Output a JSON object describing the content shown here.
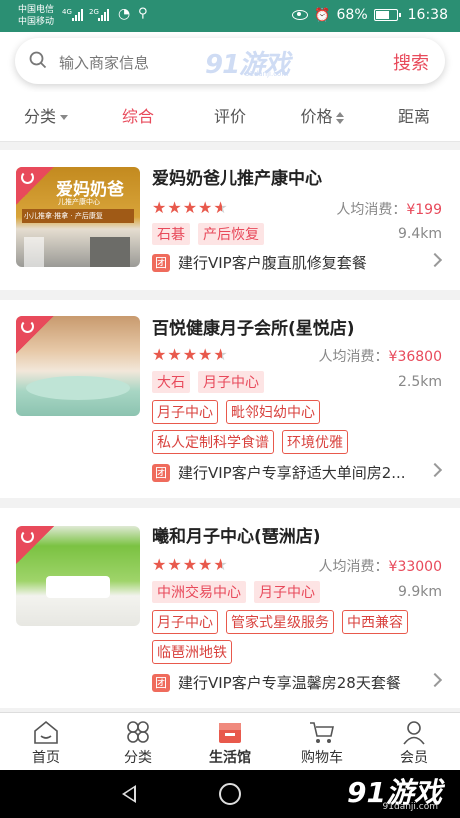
{
  "status_bar": {
    "carrier1": "中国电信",
    "carrier2": "中国移动",
    "net1": "4G",
    "net2": "2G",
    "battery": "68%",
    "time": "16:38"
  },
  "search": {
    "placeholder": "输入商家信息",
    "button": "搜索",
    "watermark": "91游戏",
    "watermark_url": "91danji.com"
  },
  "filters": [
    {
      "label": "分类",
      "active": false
    },
    {
      "label": "综合",
      "active": true
    },
    {
      "label": "评价",
      "active": false
    },
    {
      "label": "价格",
      "active": false
    },
    {
      "label": "距离",
      "active": false
    }
  ],
  "stores": [
    {
      "name": "爱妈奶爸儿推产康中心",
      "rating": 4.5,
      "avg_label": "人均消费：",
      "avg_price": "¥199",
      "area_tags": [
        "石碁",
        "产后恢复"
      ],
      "distance": "9.4km",
      "feature_tags": [],
      "deal_icon": "团",
      "deal": "建行VIP客户腹直肌修复套餐"
    },
    {
      "name": "百悦健康月子会所(星悦店)",
      "rating": 4.5,
      "avg_label": "人均消费：",
      "avg_price": "¥36800",
      "area_tags": [
        "大石",
        "月子中心"
      ],
      "distance": "2.5km",
      "feature_tags": [
        [
          "月子中心",
          "毗邻妇幼中心"
        ],
        [
          "私人定制科学食谱",
          "环境优雅"
        ]
      ],
      "deal_icon": "团",
      "deal": "建行VIP客户专享舒适大单间房2..."
    },
    {
      "name": "曦和月子中心(琶洲店)",
      "rating": 4.5,
      "avg_label": "人均消费：",
      "avg_price": "¥33000",
      "area_tags": [
        "中洲交易中心",
        "月子中心"
      ],
      "distance": "9.9km",
      "feature_tags": [
        [
          "月子中心",
          "管家式星级服务",
          "中西兼容"
        ],
        [
          "临琶洲地铁"
        ]
      ],
      "deal_icon": "团",
      "deal": "建行VIP客户专享温馨房28天套餐"
    }
  ],
  "thumb_sign": {
    "title": "爱妈奶爸",
    "sub": "儿推产康中心",
    "sub2": "小儿推拿·推拿 · 产后康复"
  },
  "tabs": [
    {
      "label": "首页",
      "icon": "home-icon"
    },
    {
      "label": "分类",
      "icon": "category-icon"
    },
    {
      "label": "生活馆",
      "icon": "store-icon"
    },
    {
      "label": "购物车",
      "icon": "cart-icon"
    },
    {
      "label": "会员",
      "icon": "user-icon"
    }
  ],
  "footer_watermark": {
    "text": "91游戏",
    "url": "91danji.com"
  },
  "colors": {
    "accent": "#e84a5b",
    "status_bar": "#2b8f73",
    "star": "#e8594c"
  }
}
